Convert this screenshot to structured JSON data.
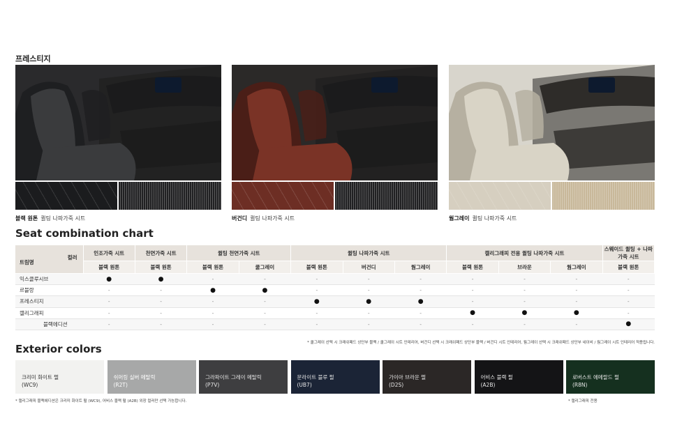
{
  "trim_title": "프레스티지",
  "interior": [
    {
      "name": "블랙 원톤",
      "desc": "퀼팅 나파가죽 시트",
      "seat": "#3a3b3d",
      "seatDark": "#1e1f21",
      "bg": "#2a2a2c",
      "dash": "#1b1b1c",
      "swatchA": "#1b1c1e",
      "swatchB": "#202022"
    },
    {
      "name": "버건디",
      "desc": "퀼팅 나파가죽 시트",
      "seat": "#7a3326",
      "seatDark": "#4a1e17",
      "bg": "#2b2928",
      "dash": "#1b1b1c",
      "swatchA": "#6d2e24",
      "swatchB": "#202022"
    },
    {
      "name": "웜그레이",
      "desc": "퀼팅 나파가죽 시트",
      "seat": "#d9d4c6",
      "seatDark": "#b6b0a1",
      "bg": "#d8d5cc",
      "dash": "#2e2c29",
      "swatchA": "#d6cfc0",
      "swatchB": "#c8b89a"
    }
  ],
  "seat_chart": {
    "title": "Seat combination chart",
    "corner_color": "컬러",
    "corner_trim": "트림명",
    "groups": [
      {
        "label": "인조가죽 시트",
        "span": 1
      },
      {
        "label": "천연가죽 시트",
        "span": 1
      },
      {
        "label": "퀼팅 천연가죽 시트",
        "span": 2
      },
      {
        "label": "퀼팅 나파가죽 시트",
        "span": 3
      },
      {
        "label": "캘리그래피 전용 퀼팅 나파가죽 시트",
        "span": 3
      },
      {
        "label": "스웨이드 퀼팅 + 나파가죽 시트",
        "span": 1
      }
    ],
    "colors": [
      "블랙 원톤",
      "블랙 원톤",
      "블랙 원톤",
      "쿨그레이",
      "블랙 원톤",
      "버건디",
      "웜그레이",
      "블랙 원톤",
      "브라운",
      "웜그레이",
      "블랙 원톤"
    ],
    "rows": [
      {
        "trim": "익스클루시브",
        "indent": false,
        "cells": [
          "●",
          "●",
          "-",
          "-",
          "-",
          "-",
          "-",
          "-",
          "-",
          "-",
          "-"
        ]
      },
      {
        "trim": "르블랑",
        "indent": false,
        "cells": [
          "-",
          "-",
          "●",
          "●",
          "-",
          "-",
          "-",
          "-",
          "-",
          "-",
          "-"
        ]
      },
      {
        "trim": "프레스티지",
        "indent": false,
        "cells": [
          "-",
          "-",
          "-",
          "-",
          "●",
          "●",
          "●",
          "-",
          "-",
          "-",
          "-"
        ]
      },
      {
        "trim": "캘리그래피",
        "indent": false,
        "cells": [
          "-",
          "-",
          "-",
          "-",
          "-",
          "-",
          "-",
          "●",
          "●",
          "●",
          "-"
        ]
      },
      {
        "trim": "블랙에디션",
        "indent": true,
        "cells": [
          "-",
          "-",
          "-",
          "-",
          "-",
          "-",
          "-",
          "-",
          "-",
          "-",
          "●"
        ]
      }
    ],
    "footnote": "* 쿨그레이 선택 시 크래쉬패드 상단부 블랙 / 쿨그레이 시트 인테리어, 버건디 선택 시 크래쉬패드 상단부 블랙 / 버건디 시트 인테리어, 웜그레이 선택 시 크래쉬패드 상단부 네이비 / 웜그레이 시트 인테리어 적용됩니다."
  },
  "exterior": {
    "title": "Exterior colors",
    "colors": [
      {
        "name": "크리미 화이트 펄",
        "code": "(WC9)",
        "color": "#f2f2f0",
        "text": "#333333"
      },
      {
        "name": "쉬머링 실버 메탈릭",
        "code": "(R2T)",
        "color": "#a7a8a8",
        "text": "#ffffff"
      },
      {
        "name": "그라파이트 그레이 메탈릭",
        "code": "(P7V)",
        "color": "#3e3e40",
        "text": "#e6e6e6"
      },
      {
        "name": "문라이트 블루 펄",
        "code": "(UB7)",
        "color": "#1b2436",
        "text": "#e6e6e6"
      },
      {
        "name": "가이아 브라운 펄",
        "code": "(D2S)",
        "color": "#2b2726",
        "text": "#e6e6e6"
      },
      {
        "name": "어비스 블랙 펄",
        "code": "(A2B)",
        "color": "#141416",
        "text": "#e6e6e6"
      },
      {
        "name": "로버스트 에메랄드 펄",
        "code": "(R8N)",
        "color": "#15301f",
        "text": "#e6e6e6"
      }
    ],
    "note_left": "* 캘리그래피 블랙에디션은 크리미 화이트 펄 (WC9), 어비스 블랙 펄 (A2B) 외장 컬러만 선택 가능합니다.",
    "note_right": "* 캘리그래피 전용"
  }
}
